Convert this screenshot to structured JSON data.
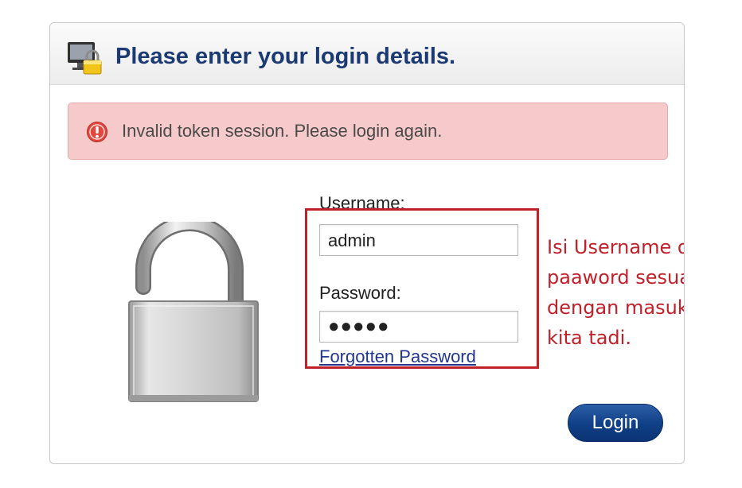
{
  "header": {
    "title": "Please enter your login details.",
    "icon": "monitor-lock-icon"
  },
  "alert": {
    "icon": "error-icon",
    "message": "Invalid token session. Please login again."
  },
  "form": {
    "username_label": "Username:",
    "username_value": "admin",
    "password_label": "Password:",
    "password_value": "●●●●●",
    "forgot_link": "Forgotten Password",
    "login_label": "Login"
  },
  "annotation": {
    "text": "Isi Username dan paaword sesuai dengan masukan kita tadi."
  },
  "colors": {
    "title": "#1b3a73",
    "alert_bg": "#f6caca",
    "annotation": "#c0202a",
    "button": "#0f3f86"
  }
}
